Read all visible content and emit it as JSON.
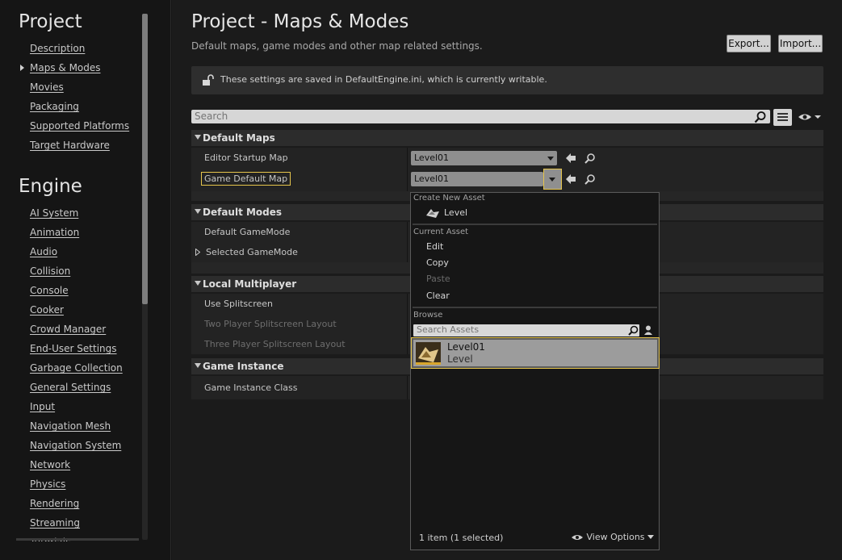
{
  "sidebar": {
    "sections": [
      {
        "title": "Project",
        "items": [
          "Description",
          "Maps & Modes",
          "Movies",
          "Packaging",
          "Supported Platforms",
          "Target Hardware"
        ]
      },
      {
        "title": "Engine",
        "items": [
          "AI System",
          "Animation",
          "Audio",
          "Collision",
          "Console",
          "Cooker",
          "Crowd Manager",
          "End-User Settings",
          "Garbage Collection",
          "General Settings",
          "Input",
          "Navigation Mesh",
          "Navigation System",
          "Network",
          "Physics",
          "Rendering",
          "Streaming",
          "Tutorials"
        ]
      }
    ],
    "selected_item": "Maps & Modes"
  },
  "header": {
    "title": "Project - Maps & Modes",
    "subtitle": "Default maps, game modes and other map related settings.",
    "export_label": "Export...",
    "import_label": "Import..."
  },
  "info": {
    "text": "These settings are saved in DefaultEngine.ini, which is currently writable."
  },
  "search": {
    "placeholder": "Search"
  },
  "categories": {
    "default_maps": {
      "title": "Default Maps",
      "rows": [
        {
          "label": "Editor Startup Map",
          "value": "Level01"
        },
        {
          "label": "Game Default Map",
          "value": "Level01"
        }
      ]
    },
    "default_modes": {
      "title": "Default Modes",
      "rows": [
        {
          "label": "Default GameMode"
        },
        {
          "label": "Selected GameMode"
        }
      ]
    },
    "local_multiplayer": {
      "title": "Local Multiplayer",
      "rows": [
        {
          "label": "Use Splitscreen"
        },
        {
          "label": "Two Player Splitscreen Layout"
        },
        {
          "label": "Three Player Splitscreen Layout"
        }
      ]
    },
    "game_instance": {
      "title": "Game Instance",
      "rows": [
        {
          "label": "Game Instance Class"
        }
      ]
    }
  },
  "dropdown": {
    "create_section": "Create New Asset",
    "create_level": "Level",
    "current_section": "Current Asset",
    "edit": "Edit",
    "copy": "Copy",
    "paste": "Paste",
    "clear": "Clear",
    "browse_section": "Browse",
    "search_placeholder": "Search Assets",
    "asset_name": "Level01",
    "asset_type": "Level",
    "footer_count": "1 item (1 selected)",
    "view_options": "View Options"
  },
  "colors": {
    "accent_highlight": "#e6c54c",
    "panel_bg": "#1b1b1b",
    "category_bg": "#2c2c2c"
  }
}
